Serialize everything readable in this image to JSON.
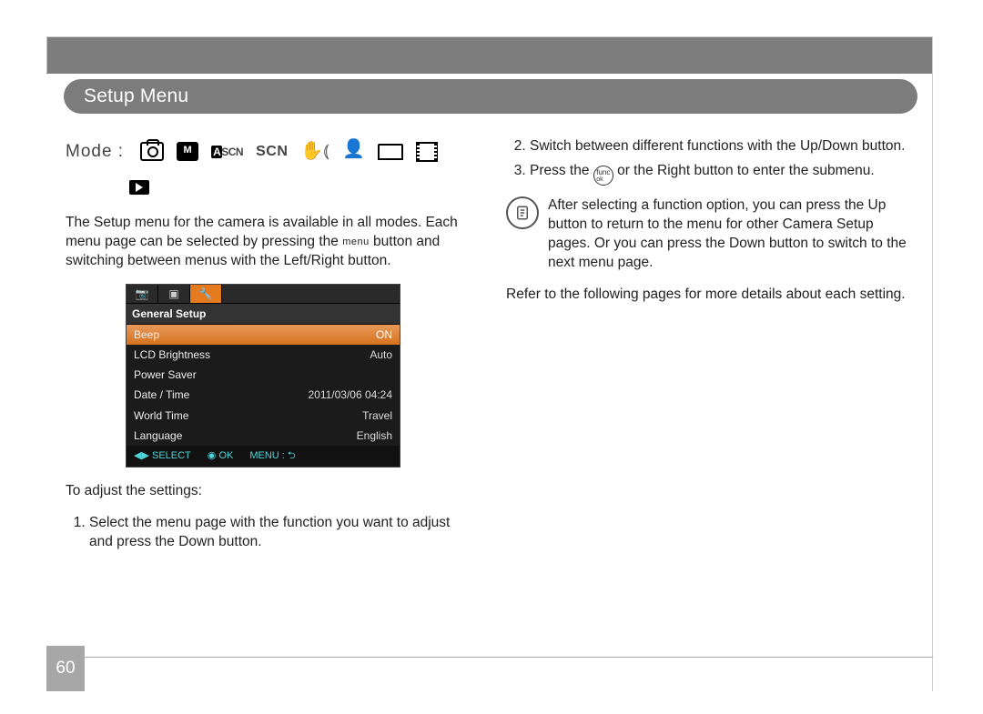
{
  "header": {
    "title": "Setup Menu"
  },
  "mode": {
    "label": "Mode :",
    "icons": [
      "camera",
      "manual",
      "ascn",
      "scn",
      "steady",
      "portrait",
      "panorama",
      "movie",
      "playback"
    ]
  },
  "intro": {
    "text_before_menu": "The Setup menu for the camera is available in all modes. Each menu page can be selected by pressing the ",
    "menu_word": "menu",
    "text_after_menu": " button and switching between menus with the Left/Right button."
  },
  "lcd": {
    "section_title": "General Setup",
    "rows": [
      {
        "label": "Beep",
        "value": "ON"
      },
      {
        "label": "LCD Brightness",
        "value": "Auto"
      },
      {
        "label": "Power Saver",
        "value": ""
      },
      {
        "label": "Date / Time",
        "value": "2011/03/06 04:24"
      },
      {
        "label": "World Time",
        "value": "Travel"
      },
      {
        "label": "Language",
        "value": "English"
      }
    ],
    "footer": {
      "select": "SELECT",
      "ok": "OK",
      "menu": "MENU :"
    }
  },
  "adjust_label": "To adjust the settings:",
  "steps": {
    "s1": "Select the menu page with the function you want to adjust and press the Down button.",
    "s2": "Switch between different functions with the Up/Down button.",
    "s3_before": "Press the ",
    "s3_after": " or the Right button to enter the submenu.",
    "func_top": "func",
    "func_bot": "ok"
  },
  "note": "After selecting a function option, you can press the Up button to return to the menu for other Camera Setup pages. Or you can press the Down button to switch to the next menu page.",
  "refer": "Refer to the following pages for more details about each setting.",
  "page_number": "60"
}
